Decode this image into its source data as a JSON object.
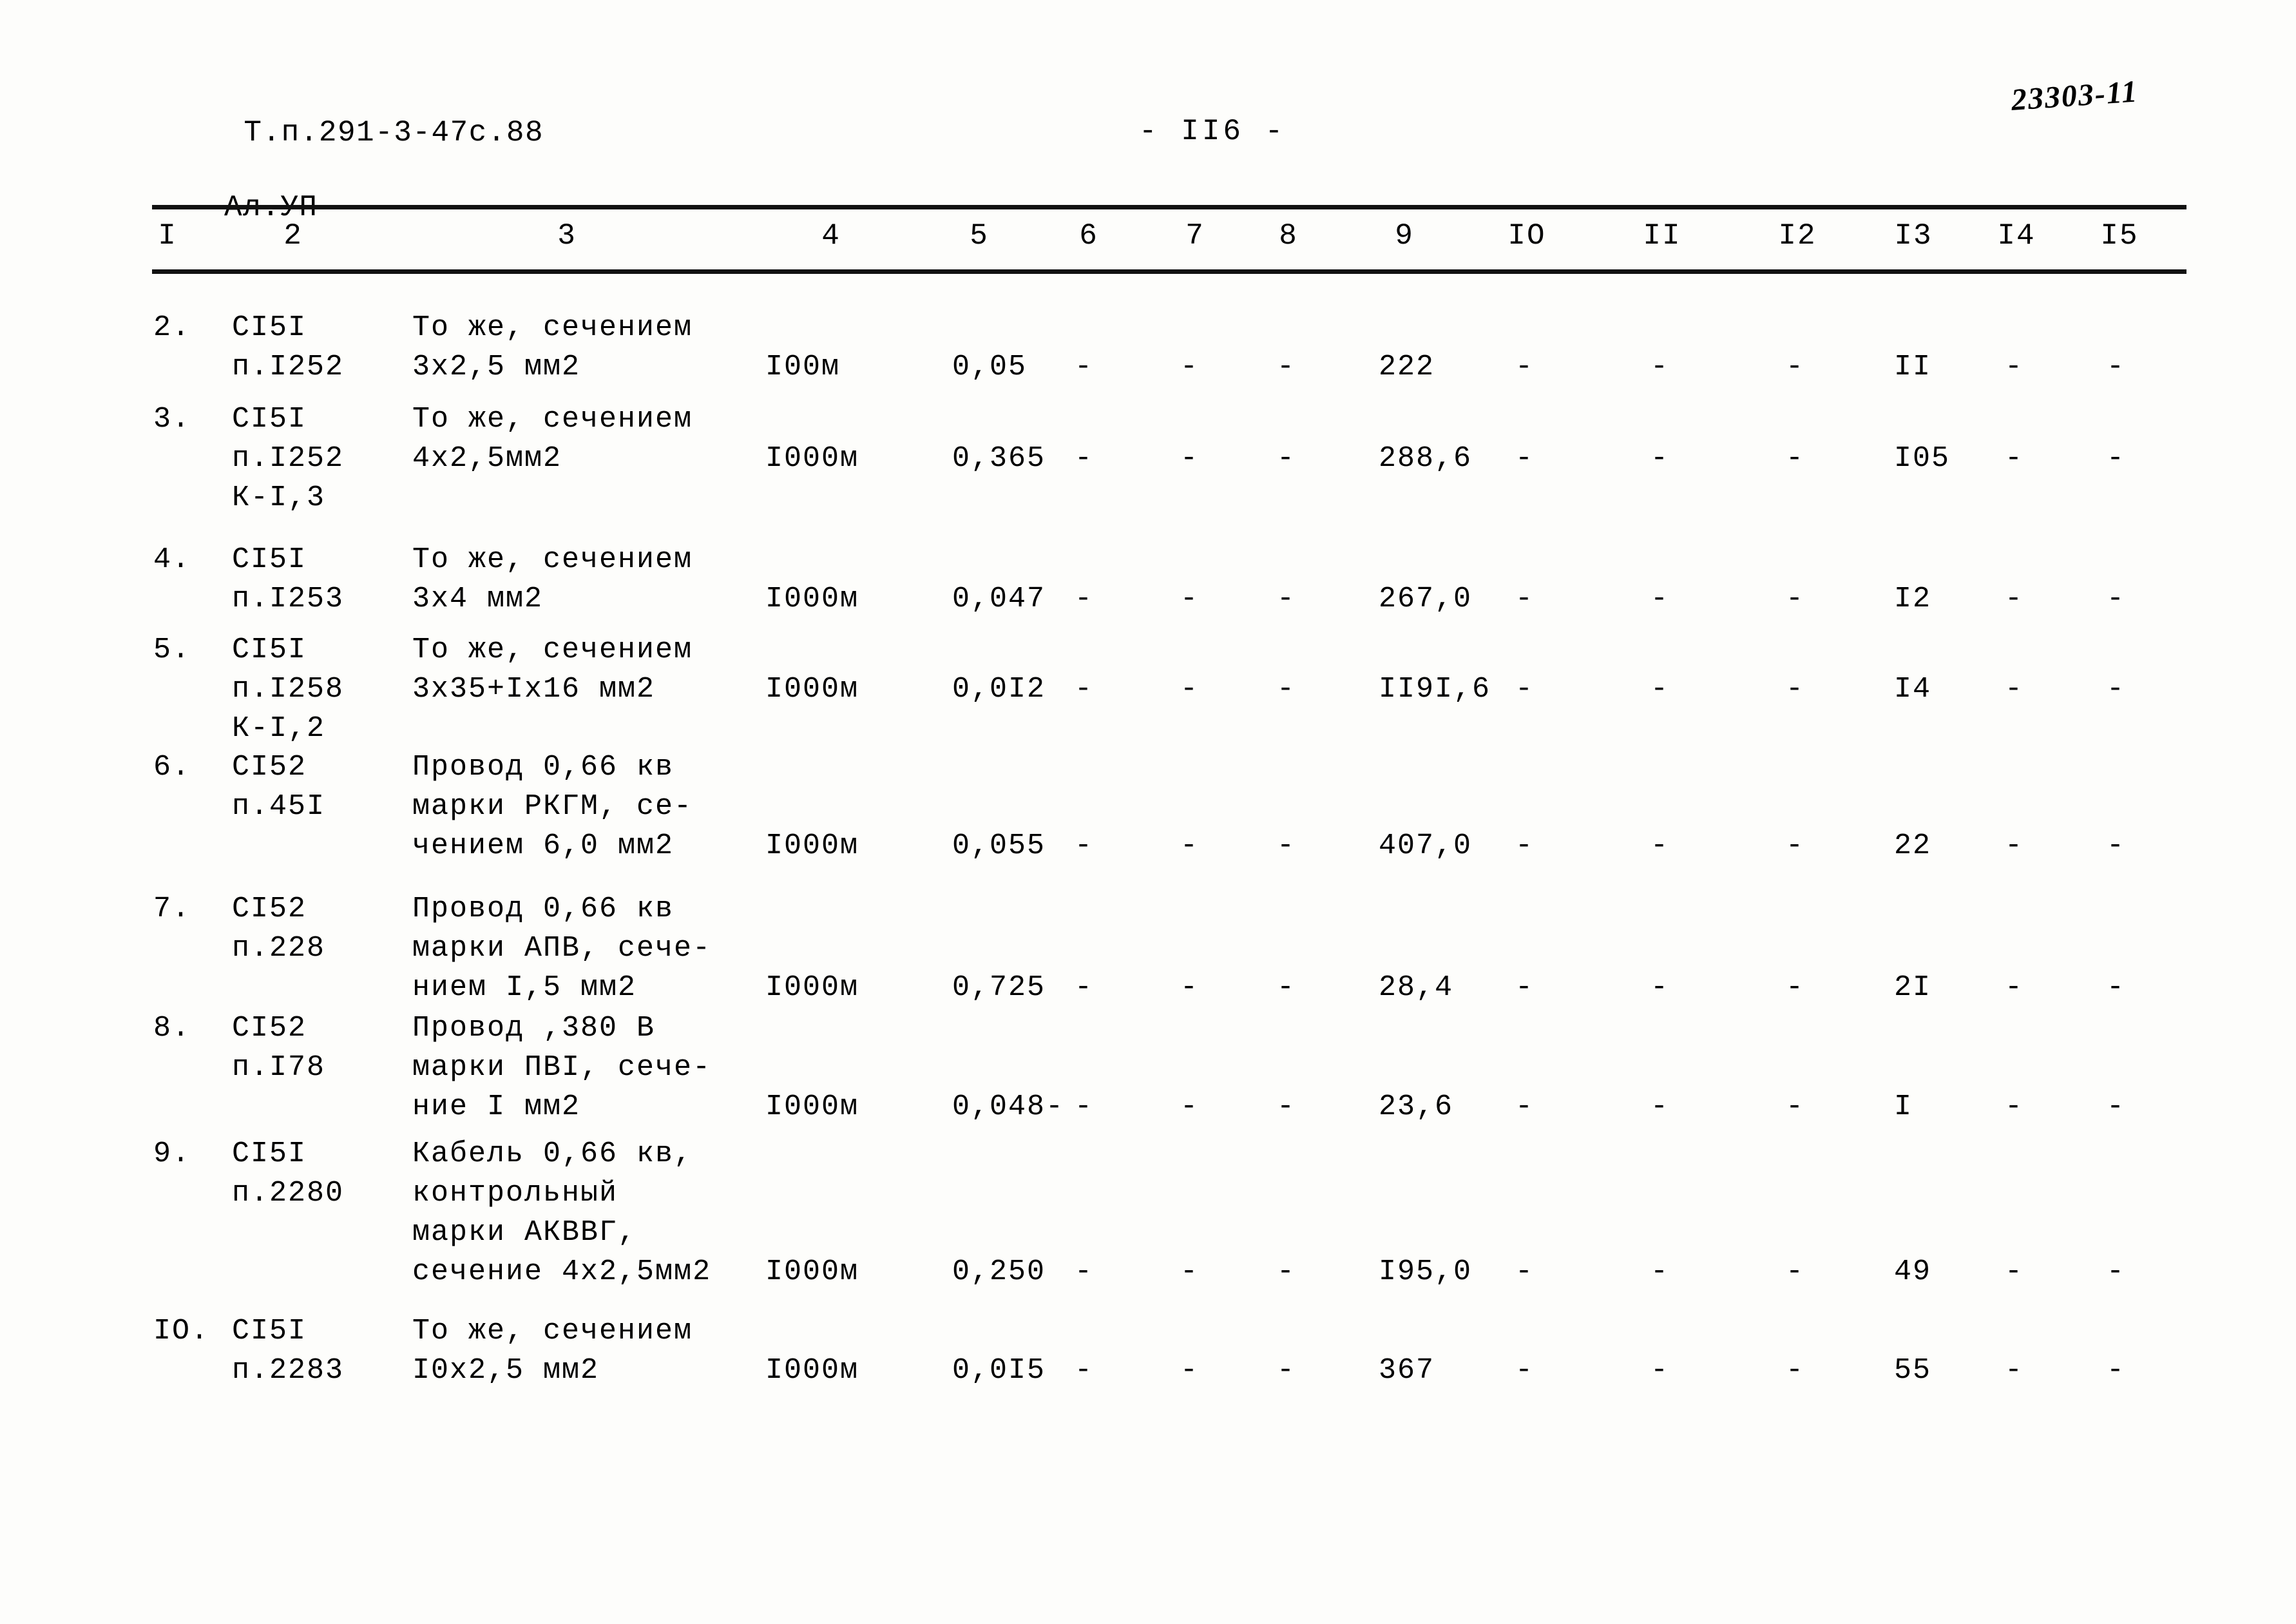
{
  "header": {
    "doc_code_line1": "Т.п.291-3-47с.88",
    "doc_code_line2": "Ал.УП",
    "page_label": "- II6 -",
    "archive_stamp": "23303-11"
  },
  "table": {
    "column_numbers": [
      "I",
      "2",
      "3",
      "4",
      "5",
      "6",
      "7",
      "8",
      "9",
      "IO",
      "II",
      "I2",
      "I3",
      "I4",
      "I5"
    ],
    "rows": [
      {
        "no": "2.",
        "code": "СI5I\nп.I252",
        "description": "То же, сечением\n3х2,5 мм2",
        "unit": "I00м",
        "c5": "0,05",
        "c6": "-",
        "c7": "-",
        "c8": "-",
        "c9": "222",
        "c10": "-",
        "c11": "-",
        "c12": "-",
        "c13": "II",
        "c14": "-",
        "c15": "-"
      },
      {
        "no": "3.",
        "code": "СI5I\nп.I252\nК-I,3",
        "description": "То же, сечением\n4х2,5мм2",
        "unit": "I000м",
        "c5": "0,365",
        "c6": "-",
        "c7": "-",
        "c8": "-",
        "c9": "288,6",
        "c10": "-",
        "c11": "-",
        "c12": "-",
        "c13": "I05",
        "c14": "-",
        "c15": "-"
      },
      {
        "no": "4.",
        "code": "СI5I\nп.I253",
        "description": "То же, сечением\n3х4 мм2",
        "unit": "I000м",
        "c5": "0,047",
        "c6": "-",
        "c7": "-",
        "c8": "-",
        "c9": "267,0",
        "c10": "-",
        "c11": "-",
        "c12": "-",
        "c13": "I2",
        "c14": "-",
        "c15": "-"
      },
      {
        "no": "5.",
        "code": "СI5I\nп.I258\nК-I,2",
        "description": "То же, сечением\n3х35+Iх16 мм2",
        "unit": "I000м",
        "c5": "0,0I2",
        "c6": "-",
        "c7": "-",
        "c8": "-",
        "c9": "II9I,6",
        "c10": "-",
        "c11": "-",
        "c12": "-",
        "c13": "I4",
        "c14": "-",
        "c15": "-"
      },
      {
        "no": "6.",
        "code": "СI52\nп.45I",
        "description": "Провод 0,66 кв\nмарки РКГМ, се-\nчением 6,0 мм2",
        "unit": "I000м",
        "c5": "0,055",
        "c6": "-",
        "c7": "-",
        "c8": "-",
        "c9": "407,0",
        "c10": "-",
        "c11": "-",
        "c12": "-",
        "c13": "22",
        "c14": "-",
        "c15": "-"
      },
      {
        "no": "7.",
        "code": "СI52\nп.228",
        "description": "Провод 0,66 кв\nмарки АПВ, сече-\nнием I,5 мм2",
        "unit": "I000м",
        "c5": "0,725",
        "c6": "-",
        "c7": "-",
        "c8": "-",
        "c9": "28,4",
        "c10": "-",
        "c11": "-",
        "c12": "-",
        "c13": "2I",
        "c14": "-",
        "c15": "-"
      },
      {
        "no": "8.",
        "code": "СI52\nп.I78",
        "description": "Провод ,380 В\nмарки ПВI, сече-\nние I мм2",
        "unit": "I000м",
        "c5": "0,048-",
        "c6": "-",
        "c7": "-",
        "c8": "-",
        "c9": "23,6",
        "c10": "-",
        "c11": "-",
        "c12": "-",
        "c13": "I",
        "c14": "-",
        "c15": "-"
      },
      {
        "no": "9.",
        "code": "СI5I\nп.2280",
        "description": "Кабель 0,66 кв,\nконтрольный\nмарки АКВВГ,\nсечение 4х2,5мм2",
        "unit": "I000м",
        "c5": "0,250",
        "c6": "-",
        "c7": "-",
        "c8": "-",
        "c9": "I95,0",
        "c10": "-",
        "c11": "-",
        "c12": "-",
        "c13": "49",
        "c14": "-",
        "c15": "-"
      },
      {
        "no": "IO.",
        "code": "СI5I\nп.2283",
        "description": "То же, сечением\nI0х2,5 мм2",
        "unit": "I000м",
        "c5": "0,0I5",
        "c6": "-",
        "c7": "-",
        "c8": "-",
        "c9": "367",
        "c10": "-",
        "c11": "-",
        "c12": "-",
        "c13": "55",
        "c14": "-",
        "c15": "-"
      }
    ]
  }
}
